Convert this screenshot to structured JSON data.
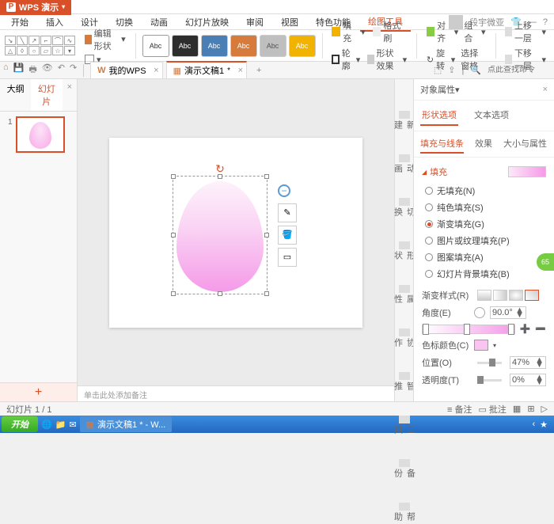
{
  "app": {
    "name": "WPS 演示"
  },
  "menu": [
    "开始",
    "插入",
    "设计",
    "切换",
    "动画",
    "幻灯片放映",
    "审阅",
    "视图",
    "特色功能",
    "绘图工具"
  ],
  "user": {
    "name": "段宇微亚"
  },
  "ribbon": {
    "edit_shape": "编辑形状",
    "styles": [
      {
        "bg": "#fff",
        "fg": "#333",
        "label": "Abc"
      },
      {
        "bg": "#2e2e2e",
        "fg": "#fff",
        "label": "Abc"
      },
      {
        "bg": "#4a7fb5",
        "fg": "#fff",
        "label": "Abc"
      },
      {
        "bg": "#d67b3c",
        "fg": "#fff",
        "label": "Abc"
      },
      {
        "bg": "#bfbfbf",
        "fg": "#555",
        "label": "Abc"
      },
      {
        "bg": "#f2b200",
        "fg": "#fff",
        "label": "Abc"
      }
    ],
    "fill": "填充",
    "format_painter": "格式刷",
    "outline": "轮廓",
    "shape_effects": "形状效果",
    "align": "对齐",
    "group": "组合",
    "rotate": "旋转",
    "select_pane": "选择窗格",
    "bring_fwd": "上移一层",
    "send_back": "下移一层"
  },
  "tabs": {
    "wps_tab": "我的WPS",
    "doc_tab": "演示文稿1"
  },
  "search_placeholder": "点此查找命令",
  "left_panel": {
    "outline": "大纲",
    "slides": "幻灯片",
    "thumb_num": "1"
  },
  "notes_placeholder": "单击此处添加备注",
  "rail": [
    "新建",
    "动画",
    "切换",
    "形状",
    "属性",
    "协作",
    "智推",
    "工具",
    "备份",
    "帮助"
  ],
  "props": {
    "title": "对象属性",
    "tab_shape": "形状选项",
    "tab_text": "文本选项",
    "sub_fill": "填充与线条",
    "sub_effect": "效果",
    "sub_size": "大小与属性",
    "sec_fill": "填充",
    "fill_options": [
      "无填充(N)",
      "纯色填充(S)",
      "渐变填充(G)",
      "图片或纹理填充(P)",
      "图案填充(A)",
      "幻灯片背景填充(B)"
    ],
    "selected_fill": 2,
    "grad_style": "渐变样式(R)",
    "angle": "角度(E)",
    "angle_val": "90.0°",
    "color_stop": "色标颜色(C)",
    "position": "位置(O)",
    "position_val": "47%",
    "opacity": "透明度(T)",
    "opacity_val": "0%"
  },
  "status": {
    "slide": "幻灯片 1 / 1",
    "notes": "备注",
    "comments": "批注"
  },
  "taskbar": {
    "start": "开始",
    "task": "演示文稿1 * - W..."
  },
  "badge": "65"
}
